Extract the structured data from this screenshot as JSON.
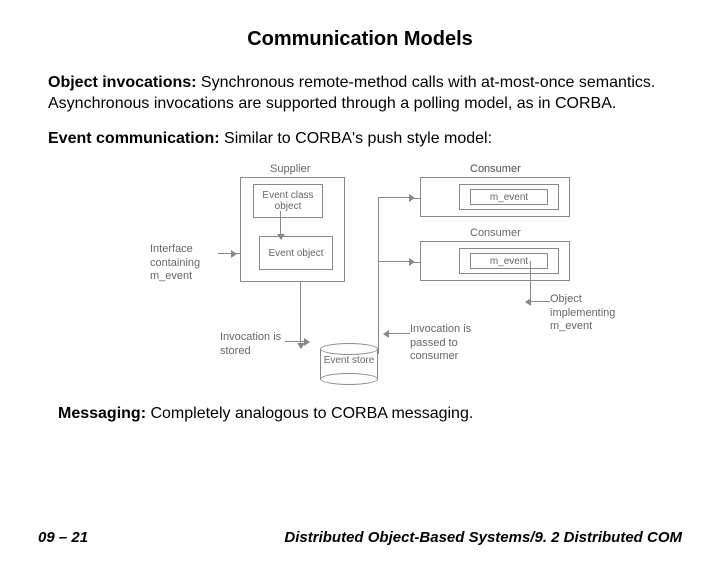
{
  "title": "Communication Models",
  "para1": {
    "label": "Object invocations:",
    "text": " Synchronous remote-method calls with at-most-once semantics. Asynchronous invocations are supported through a polling model, as in CORBA."
  },
  "para2": {
    "label": "Event communication:",
    "text": " Similar to CORBA's push style model:"
  },
  "diagram": {
    "supplier": "Supplier",
    "consumer": "Consumer",
    "event_class_object": "Event class object",
    "event_object": "Event object",
    "m_event": "m_event",
    "interface_label": "Interface containing m_event",
    "invocation_stored": "Invocation is stored",
    "invocation_passed": "Invocation is passed to consumer",
    "object_implementing": "Object implementing m_event",
    "event_store": "Event store"
  },
  "messaging": {
    "label": "Messaging:",
    "text": " Completely analogous to CORBA messaging."
  },
  "footer": {
    "left": "09 – 21",
    "right": "Distributed Object-Based Systems/9. 2 Distributed COM"
  }
}
